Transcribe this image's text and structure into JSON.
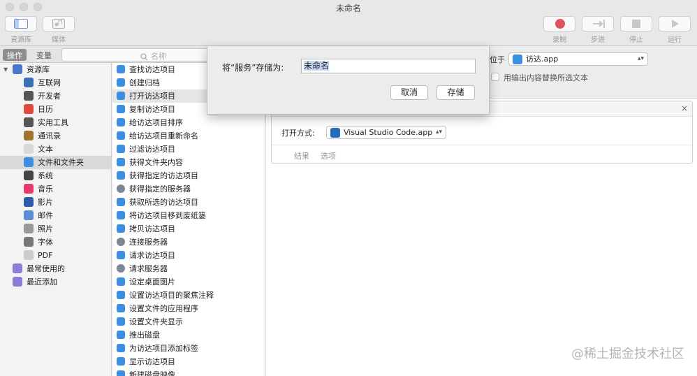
{
  "window": {
    "title": "未命名"
  },
  "toolbar": {
    "left": [
      {
        "label": "资源库",
        "icon": "library-icon"
      },
      {
        "label": "媒体",
        "icon": "media-icon"
      }
    ],
    "right": [
      {
        "label": "录制",
        "icon": "record-icon"
      },
      {
        "label": "步进",
        "icon": "step-icon"
      },
      {
        "label": "停止",
        "icon": "stop-icon"
      },
      {
        "label": "运行",
        "icon": "run-icon"
      }
    ]
  },
  "subbar": {
    "actions_tab": "操作",
    "variables_tab": "变量",
    "search_placeholder": "名称"
  },
  "library": {
    "items": [
      {
        "label": "资源库",
        "icon": "library-icon",
        "color": "#4a78c9"
      },
      {
        "label": "互联网",
        "icon": "globe-icon",
        "color": "#3d6fb5"
      },
      {
        "label": "开发者",
        "icon": "developer-tools-icon",
        "color": "#555555"
      },
      {
        "label": "日历",
        "icon": "calendar-icon",
        "color": "#e04a3a"
      },
      {
        "label": "实用工具",
        "icon": "utilities-icon",
        "color": "#555555"
      },
      {
        "label": "通讯录",
        "icon": "contacts-icon",
        "color": "#a0742f"
      },
      {
        "label": "文本",
        "icon": "text-icon",
        "color": "#d8d8d8"
      },
      {
        "label": "文件和文件夹",
        "icon": "finder-icon",
        "color": "#3b8ee0"
      },
      {
        "label": "系统",
        "icon": "system-icon",
        "color": "#444444"
      },
      {
        "label": "音乐",
        "icon": "music-icon",
        "color": "#e8386d"
      },
      {
        "label": "影片",
        "icon": "movie-icon",
        "color": "#2b5ea8"
      },
      {
        "label": "邮件",
        "icon": "mail-icon",
        "color": "#5a8fd6"
      },
      {
        "label": "照片",
        "icon": "photos-icon",
        "color": "#999999"
      },
      {
        "label": "字体",
        "icon": "font-icon",
        "color": "#777777"
      },
      {
        "label": "PDF",
        "icon": "pdf-icon",
        "color": "#cccccc"
      },
      {
        "label": "最常使用的",
        "icon": "smart-folder-icon",
        "color": "#8e7bd6"
      },
      {
        "label": "最近添加",
        "icon": "smart-folder-icon",
        "color": "#8e7bd6"
      }
    ]
  },
  "actions": {
    "items": [
      {
        "label": "查找访达项目",
        "icon": "finder-icon"
      },
      {
        "label": "创建归档",
        "icon": "finder-icon"
      },
      {
        "label": "打开访达项目",
        "icon": "finder-icon"
      },
      {
        "label": "复制访达项目",
        "icon": "finder-icon"
      },
      {
        "label": "给访达项目排序",
        "icon": "finder-icon"
      },
      {
        "label": "给访达项目重新命名",
        "icon": "finder-icon"
      },
      {
        "label": "过滤访达项目",
        "icon": "finder-icon"
      },
      {
        "label": "获得文件夹内容",
        "icon": "finder-icon"
      },
      {
        "label": "获得指定的访达项目",
        "icon": "finder-icon"
      },
      {
        "label": "获得指定的服务器",
        "icon": "server-icon"
      },
      {
        "label": "获取所选的访达项目",
        "icon": "finder-icon"
      },
      {
        "label": "将访达项目移到废纸篓",
        "icon": "finder-icon"
      },
      {
        "label": "拷贝访达项目",
        "icon": "finder-icon"
      },
      {
        "label": "连接服务器",
        "icon": "server-icon"
      },
      {
        "label": "请求访达项目",
        "icon": "finder-icon"
      },
      {
        "label": "请求服务器",
        "icon": "server-icon"
      },
      {
        "label": "设定桌面图片",
        "icon": "finder-icon"
      },
      {
        "label": "设置访达项目的聚焦注释",
        "icon": "finder-icon"
      },
      {
        "label": "设置文件的应用程序",
        "icon": "finder-icon"
      },
      {
        "label": "设置文件夹显示",
        "icon": "finder-icon"
      },
      {
        "label": "推出磁盘",
        "icon": "finder-icon"
      },
      {
        "label": "为访达项目添加标签",
        "icon": "finder-icon"
      },
      {
        "label": "显示访达项目",
        "icon": "finder-icon"
      },
      {
        "label": "新建磁盘映像",
        "icon": "finder-icon"
      }
    ]
  },
  "workflow": {
    "location_label": "位于",
    "location_value": "访达.app",
    "replace_label": "用输出内容替换所选文本",
    "card": {
      "open_with_label": "打开方式:",
      "open_with_value": "Visual Studio Code.app",
      "results_tab": "结果",
      "options_tab": "选项"
    }
  },
  "sheet": {
    "prompt": "将“服务”存储为:",
    "name_value": "未命名",
    "cancel_label": "取消",
    "save_label": "存储"
  },
  "watermark": "@稀土掘金技术社区"
}
